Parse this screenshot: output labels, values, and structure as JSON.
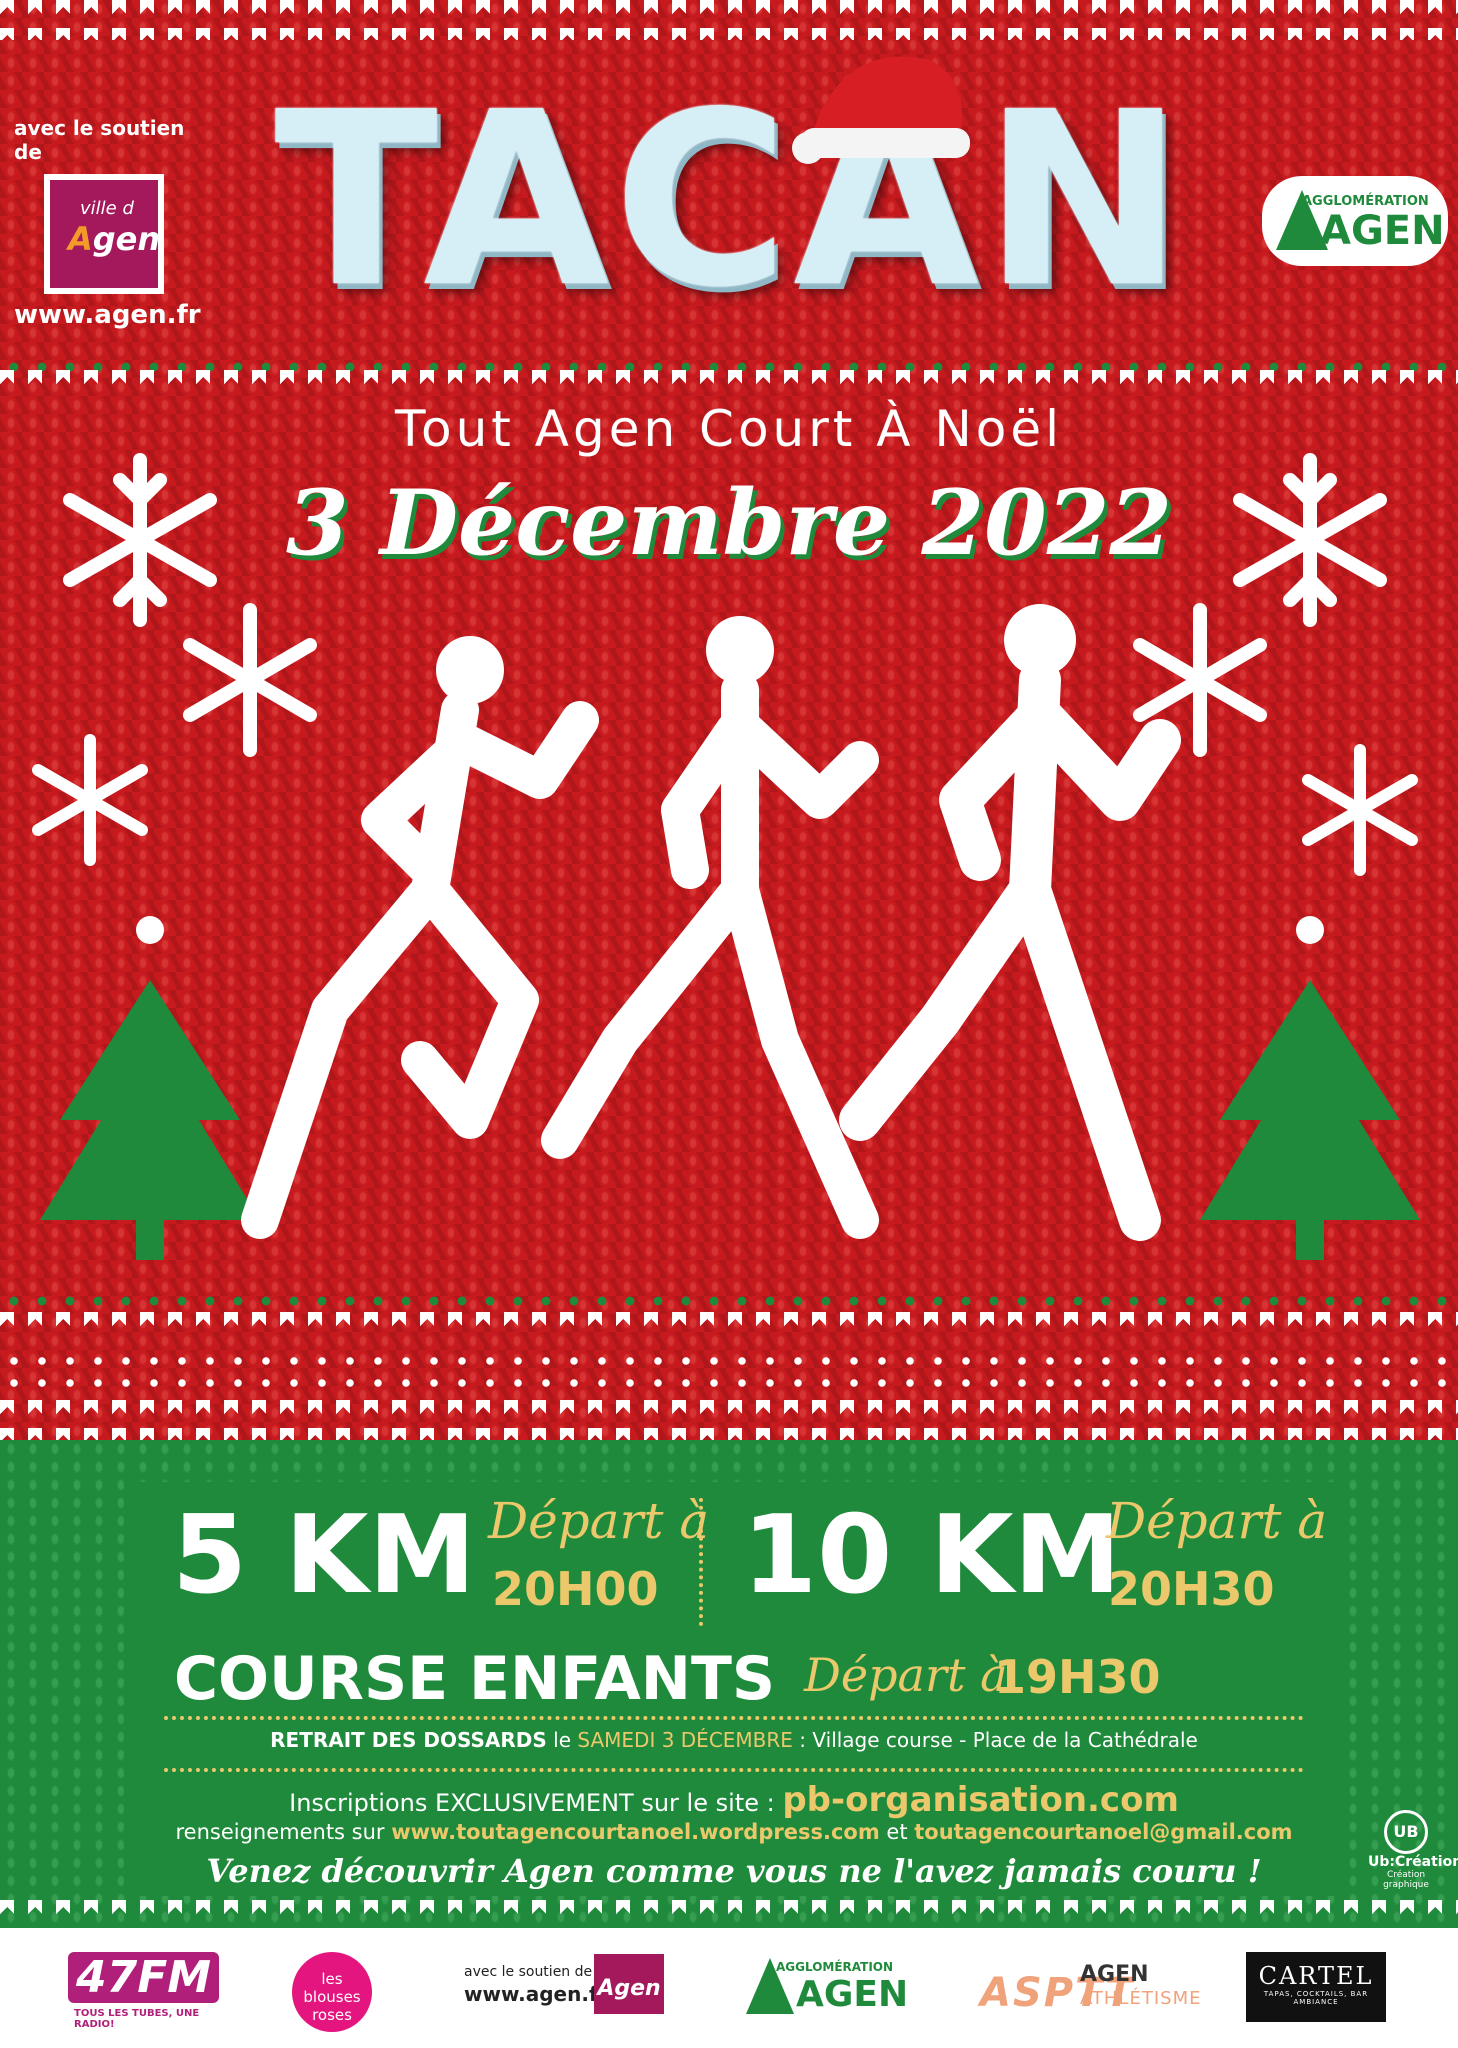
{
  "header": {
    "support_label": "avec le soutien de",
    "ville_small": "ville d",
    "ville_big_first": "A",
    "ville_big_rest": "gen",
    "website": "www.agen.fr",
    "title": "TACAN",
    "agglo_small": "AGGLOMÉRATION",
    "agglo_big": "AGEN"
  },
  "event": {
    "subtitle": "Tout Agen Court À Noël",
    "date": "3 Décembre 2022"
  },
  "races": {
    "r5_distance": "5 KM",
    "r5_depart": "Départ à",
    "r5_time": "20H00",
    "r10_distance": "10 KM",
    "r10_depart": "Départ à",
    "r10_time": "20H30",
    "kids_label": "COURSE ENFANTS",
    "kids_depart": "Départ à",
    "kids_time": "19H30"
  },
  "info": {
    "retrait_bold": "RETRAIT DES DOSSARDS",
    "retrait_le": " le ",
    "retrait_date": "SAMEDI 3 DÉCEMBRE",
    "retrait_rest": " : Village course - Place de la Cathédrale",
    "inscr_text": "Inscriptions EXCLUSIVEMENT sur le site : ",
    "inscr_site": "pb-organisation.com",
    "rens_text": "renseignements sur ",
    "rens_site": "www.toutagencourtanoel.wordpress.com",
    "rens_et": " et ",
    "rens_mail": "toutagencourtanoel@gmail.com",
    "slogan": "Venez découvrir Agen comme vous ne l'avez jamais couru !"
  },
  "credit": {
    "brand": "Ub:Création",
    "sub": "Création graphique"
  },
  "footer": {
    "radio_name": "47FM",
    "radio_tag": "TOUS LES TUBES, UNE RADIO!",
    "blouses": "les blouses roses",
    "support_label": "avec le soutien de",
    "website": "www.agen.fr",
    "ville": "Agen",
    "agglo_small": "AGGLOMÉRATION",
    "agglo_big": "AGEN",
    "asptt": "ASPTT",
    "asptt_city": "AGEN",
    "asptt_sport": "ATHLÉTISME",
    "cartel": "CARTEL",
    "cartel_sub": "TAPAS, COCKTAILS, BAR AMBIANCE"
  },
  "colors": {
    "red": "#c71a1f",
    "green": "#1f8a3c",
    "gold": "#ebc86b",
    "white": "#ffffff"
  }
}
